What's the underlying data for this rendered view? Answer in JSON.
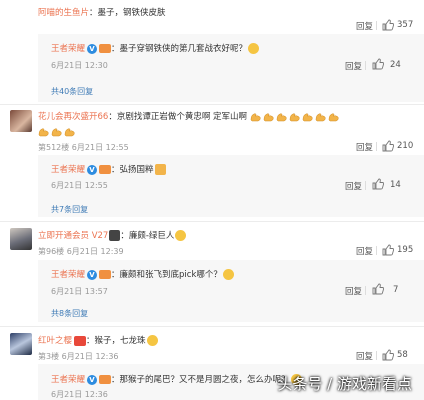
{
  "colors": {
    "link": "#eb7350",
    "blue": "#3f7bb6"
  },
  "top": {
    "username": "阿喵的生鱼片",
    "text": "：墨子，钢铁侠皮肤",
    "reply": "回复",
    "likes": "357"
  },
  "r1": {
    "username": "王者荣耀",
    "text": "：墨子穿钢铁侠的第几套战衣好呢？",
    "time": "6月21日 12:30",
    "reply": "回复",
    "likes": "24",
    "more": "共40条回复"
  },
  "c2": {
    "username": "花儿会再次盛开66",
    "text": "：京剧找谭正岩做个黄忠啊   定军山啊",
    "floor": "第512楼 6月21日 12:55",
    "reply": "回复",
    "likes": "210"
  },
  "r2": {
    "username": "王者荣耀",
    "text": "：弘扬国粹",
    "time": "6月21日 12:55",
    "reply": "回复",
    "likes": "14",
    "more": "共7条回复"
  },
  "c3": {
    "username": "立即开通会员 V27",
    "text": "：廉颇-绿巨人",
    "floor": "第96楼 6月21日 12:39",
    "reply": "回复",
    "likes": "195"
  },
  "r3": {
    "username": "王者荣耀",
    "text": "：廉颇和张飞到底pick哪个？",
    "time": "6月21日 13:57",
    "reply": "回复",
    "likes": "7",
    "more": "共8条回复"
  },
  "c4": {
    "username": "红叶之樱",
    "text": "：猴子，七龙珠",
    "floor": "第3楼 6月21日 12:36",
    "reply": "回复",
    "likes": "58"
  },
  "r4": {
    "username": "王者荣耀",
    "text": "：那猴子的尾巴？又不是月圆之夜，怎么办呢？",
    "time": "6月21日 12:36"
  },
  "watermark": "头条号 / 游戏新看点"
}
